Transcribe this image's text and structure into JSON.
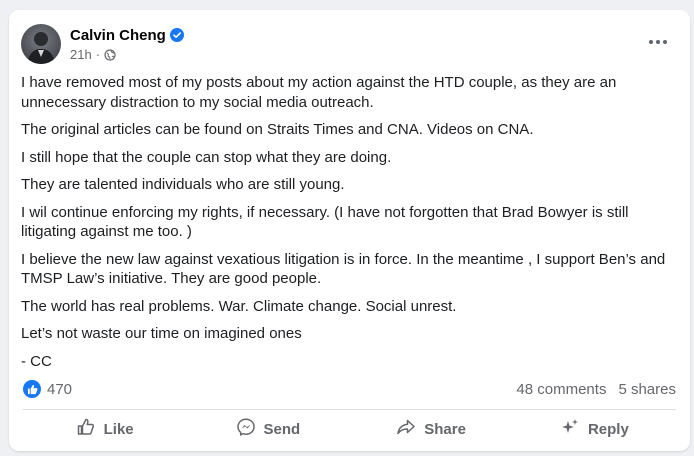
{
  "post": {
    "author": "Calvin Cheng",
    "time": "21h",
    "paragraphs": [
      "I have removed most of my posts about my action against the HTD couple,  as they are an unnecessary distraction to my social media outreach.",
      "The original articles can be found on Straits Times and CNA. Videos on CNA.",
      "I still hope that the couple can stop what they are doing.",
      "They are talented individuals who are still young.",
      "I wil continue enforcing my rights, if necessary. (I have not forgotten that Brad Bowyer is still litigating against me too. )",
      "I believe the new law against vexatious litigation is in force. In the meantime , I support Ben’s and TMSP Law’s initiative. They are good people.",
      "The world has real problems. War. Climate change. Social unrest.",
      "Let’s not waste our time on imagined ones",
      "- CC"
    ],
    "reactions_count": "470",
    "comments": "48 comments",
    "shares": "5 shares"
  },
  "actions": {
    "like": "Like",
    "send": "Send",
    "share": "Share",
    "reply": "Reply"
  },
  "icons": {
    "verified": "verified-badge-icon",
    "privacy": "globe-icon",
    "more": "more-options-icon",
    "reaction": "thumbs-up-icon"
  },
  "colors": {
    "accent": "#1877f2",
    "secondary_text": "#65676b"
  }
}
